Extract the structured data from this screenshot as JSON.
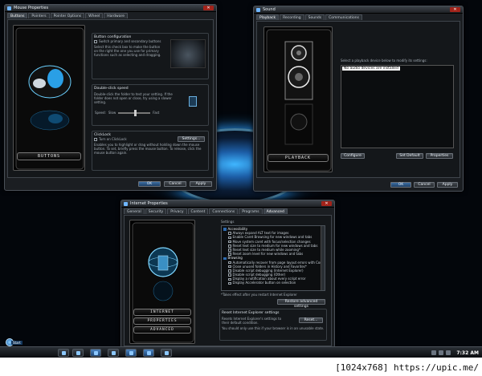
{
  "mouse": {
    "title": "Mouse Properties",
    "tabs": [
      "Buttons",
      "Pointers",
      "Pointer Options",
      "Wheel",
      "Hardware"
    ],
    "art_caption": "BUTTONS",
    "group1": {
      "title": "Button configuration",
      "check": "Switch primary and secondary buttons",
      "text": "Select this check box to make the button on the right the one you use for primary functions such as selecting and dragging."
    },
    "group2": {
      "title": "Double-click speed",
      "text": "Double-click the folder to test your setting. If the folder does not open or close, try using a slower setting.",
      "speed": "Speed:",
      "slow": "Slow",
      "fast": "Fast"
    },
    "group3": {
      "title": "ClickLock",
      "check": "Turn on ClickLock",
      "settings": "Settings...",
      "text": "Enables you to highlight or drag without holding down the mouse button. To set, briefly press the mouse button. To release, click the mouse button again."
    },
    "ok": "OK",
    "cancel": "Cancel",
    "apply": "Apply"
  },
  "sound": {
    "title": "Sound",
    "tabs": [
      "Playback",
      "Recording",
      "Sounds",
      "Communications"
    ],
    "art_caption": "PLAYBACK",
    "instruction": "Select a playback device below to modify its settings:",
    "no_devices": "No audio devices are installed",
    "configure": "Configure",
    "set_default": "Set Default",
    "properties": "Properties",
    "ok": "OK",
    "cancel": "Cancel",
    "apply": "Apply"
  },
  "internet": {
    "title": "Internet Properties",
    "tabs": [
      "General",
      "Security",
      "Privacy",
      "Content",
      "Connections",
      "Programs",
      "Advanced"
    ],
    "art_caption_1": "INTERNET",
    "art_caption_2": "PROPERTIES",
    "art_caption_3": "ADVANCED",
    "settings_label": "Settings",
    "tree": [
      {
        "label": "Accessibility",
        "cat": true
      },
      {
        "label": "Always expand ALT text for images",
        "cat": false
      },
      {
        "label": "Enable Caret Browsing for new windows and tabs",
        "cat": false
      },
      {
        "label": "Move system caret with focus/selection changes",
        "cat": false
      },
      {
        "label": "Reset text size to medium for new windows and tabs",
        "cat": false
      },
      {
        "label": "Reset text size to medium while zooming*",
        "cat": false
      },
      {
        "label": "Reset zoom level for new windows and tabs",
        "cat": false
      },
      {
        "label": "Browsing",
        "cat": true
      },
      {
        "label": "Automatically recover from page layout errors with Compa",
        "cat": false
      },
      {
        "label": "Close unused folders in History and Favorites*",
        "cat": false
      },
      {
        "label": "Disable script debugging (Internet Explorer)",
        "cat": false
      },
      {
        "label": "Disable script debugging (Other)",
        "cat": false
      },
      {
        "label": "Display a notification about every script error",
        "cat": false
      },
      {
        "label": "Display Accelerator button on selection",
        "cat": false
      }
    ],
    "restart_note": "*Takes effect after you restart Internet Explorer",
    "restore_advanced": "Restore advanced settings",
    "reset_title": "Reset Internet Explorer settings",
    "reset_text": "Resets Internet Explorer's settings to their default condition.",
    "reset_button": "Reset...",
    "reset_note": "You should only use this if your browser is in an unusable state.",
    "ok": "OK",
    "cancel": "Cancel",
    "apply": "Apply"
  },
  "taskbar": {
    "start": "Start",
    "clock": "7:32 AM"
  },
  "watermark": "[1024x768] https://upic.me/"
}
